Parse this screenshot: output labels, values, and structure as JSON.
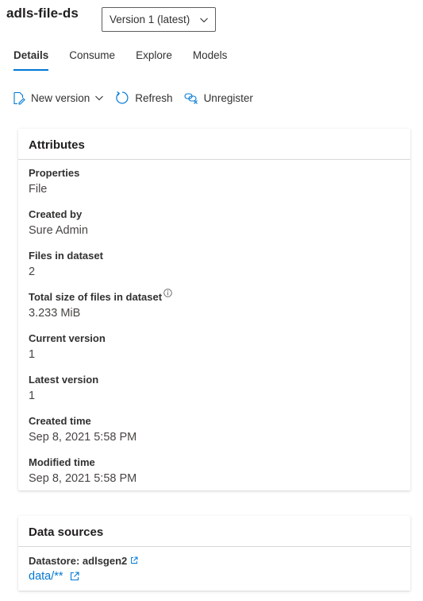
{
  "header": {
    "title": "adls-file-ds",
    "version_selected": "Version 1 (latest)"
  },
  "tabs": [
    {
      "label": "Details",
      "active": true
    },
    {
      "label": "Consume",
      "active": false
    },
    {
      "label": "Explore",
      "active": false
    },
    {
      "label": "Models",
      "active": false
    }
  ],
  "toolbar": {
    "new_version_label": "New version",
    "refresh_label": "Refresh",
    "unregister_label": "Unregister"
  },
  "attributes": {
    "heading": "Attributes",
    "items": [
      {
        "label": "Properties",
        "value": "File"
      },
      {
        "label": "Created by",
        "value": "Sure Admin"
      },
      {
        "label": "Files in dataset",
        "value": "2"
      },
      {
        "label": "Total size of files in dataset",
        "value": "3.233 MiB"
      },
      {
        "label": "Current version",
        "value": "1"
      },
      {
        "label": "Latest version",
        "value": "1"
      },
      {
        "label": "Created time",
        "value": "Sep 8, 2021 5:58 PM"
      },
      {
        "label": "Modified time",
        "value": "Sep 8, 2021 5:58 PM"
      }
    ]
  },
  "data_sources": {
    "heading": "Data sources",
    "datastore_label": "Datastore: adlsgen2",
    "path_link": "data/**"
  },
  "colors": {
    "accent": "#0078d4",
    "text": "#323130",
    "border": "#605e5c"
  }
}
